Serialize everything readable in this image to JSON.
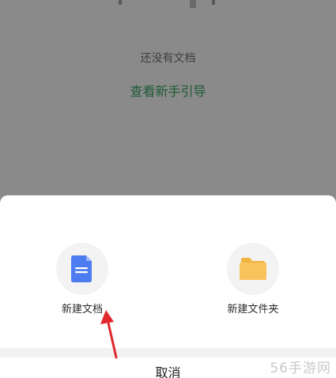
{
  "background": {
    "empty_state_text": "还没有文档",
    "guide_link_label": "查看新手引导"
  },
  "sheet": {
    "actions": [
      {
        "label": "新建文档",
        "icon": "document-icon"
      },
      {
        "label": "新建文件夹",
        "icon": "folder-icon"
      }
    ],
    "cancel_label": "取消"
  },
  "watermark": "56手游网",
  "colors": {
    "overlay": "#8a8a8a",
    "guide_link": "#1f5a35",
    "doc_icon": "#4d7cf0",
    "folder_icon": "#f7c35a",
    "arrow": "#e0282d"
  }
}
